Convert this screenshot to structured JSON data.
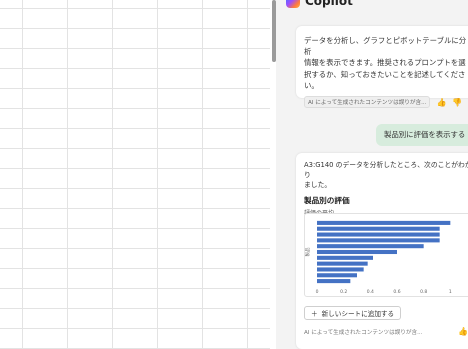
{
  "copilot": {
    "title": "Copilot",
    "intro_text": "データを分析し、グラフとピボットテーブルに分析\n情報を表示できます。推奨されるプロンプトを選\n択するか、知っておきたいことを記述してください。",
    "ai_note": "AI によって生成されたコンテンツは誤りが含...",
    "user_message": "製品別に評価を表示する",
    "answer_intro": "A3:G140 のデータを分析したところ、次のことがわかり\nました。",
    "answer_title": "製品別の評価",
    "answer_subtitle": "評価の平均",
    "add_sheet_label": "新しいシートに追加する",
    "answer_ai_note": "AI によって生成されたコンテンツは誤りが含...",
    "icons": [
      "copilot-logo-icon",
      "thumbs-up-icon",
      "thumbs-down-icon",
      "plus-icon"
    ],
    "accent": "#4472c4"
  },
  "chart_data": {
    "type": "bar",
    "orientation": "horizontal",
    "ylabel": "製品",
    "x_ticks": [
      "0",
      "0.2",
      "0.4",
      "0.6",
      "0.8",
      "1",
      "1.2"
    ],
    "xlim": [
      0,
      1.2
    ],
    "values": [
      1.0,
      0.92,
      0.92,
      0.92,
      0.8,
      0.6,
      0.42,
      0.38,
      0.35,
      0.3,
      0.25
    ],
    "color": "#4472c4"
  }
}
